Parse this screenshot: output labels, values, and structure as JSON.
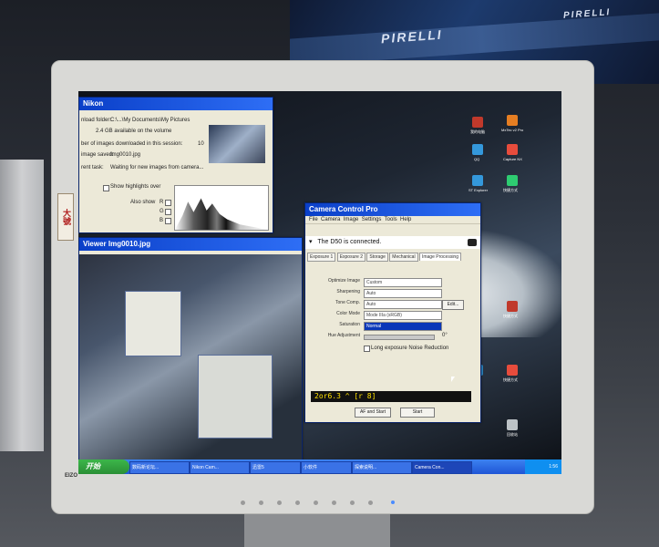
{
  "poster": {
    "brand_texts": [
      "PIRELLI",
      "PIRELLI"
    ]
  },
  "monitor": {
    "logo": "EIZO",
    "stickers": [
      "大號",
      "招牌"
    ]
  },
  "image_window": {
    "title": "Nikon",
    "download_folder_label": "nload folder:",
    "download_folder_value": "C:\\...\\My Documents\\My Pictures",
    "volume_text": "2.4 GB available on the volume",
    "images_downloaded_label": "ber of images downloaded in this session:",
    "images_downloaded_value": "10",
    "image_saved_label": "image saved:",
    "image_saved_value": "Img0010.jpg",
    "current_task_label": "rent task:",
    "current_task_value": "Waiting for new images from camera...",
    "show_highlights_label": "Show highlights over",
    "also_show_label": "Also show",
    "channels": [
      "R",
      "G",
      "B"
    ]
  },
  "viewer_window": {
    "title": "Viewer Img0010.jpg"
  },
  "ccp_window": {
    "title": "Camera Control Pro",
    "menus": [
      "File",
      "Camera",
      "Image",
      "Settings",
      "Tools",
      "Help"
    ],
    "connected_text": "The D50 is connected.",
    "tabs": [
      "Exposure 1",
      "Exposure 2",
      "Storage",
      "Mechanical",
      "Image Processing"
    ],
    "fields": [
      {
        "label": "Optimize Image",
        "value": "Custom"
      },
      {
        "label": "Sharpening",
        "value": "Auto"
      },
      {
        "label": "Tone Comp.",
        "value": "Auto"
      },
      {
        "label": "Color Mode",
        "value": "Mode IIIa (sRGB)"
      },
      {
        "label": "Saturation",
        "value": "Normal"
      }
    ],
    "hue_label": "Hue Adjustment",
    "hue_value": "0°",
    "noise_label": "Long exposure Noise Reduction",
    "lcd_text": "2or6.3  ^  [r 8]",
    "af_button": "AF and Start",
    "start_button": "Start",
    "edit_button": "Edit..."
  },
  "taskbar": {
    "start_label": "开始",
    "tasks": [
      "数码新论坛...",
      "Nikon Cam...",
      "迅雷5",
      "小软件",
      "探索说明...",
      "Camera Con..."
    ],
    "clock": "1:56"
  },
  "desktop_icons": [
    {
      "label": "我的电脑",
      "color": "#c0392b"
    },
    {
      "label": "MxTec v2 Pro",
      "color": "#e67e22"
    },
    {
      "label": "QQ",
      "color": "#3498db"
    },
    {
      "label": "Capture NX",
      "color": "#e74c3c"
    },
    {
      "label": "快捷方式",
      "color": "#2ecc71"
    },
    {
      "label": "ST Explorer",
      "color": "#3498db"
    },
    {
      "label": "快捷方式",
      "color": "#c0392b"
    },
    {
      "label": "QQ",
      "color": "#2980b9"
    },
    {
      "label": "快捷方式",
      "color": "#e74c3c"
    },
    {
      "label": "回收站",
      "color": "#bdc3c7"
    }
  ]
}
